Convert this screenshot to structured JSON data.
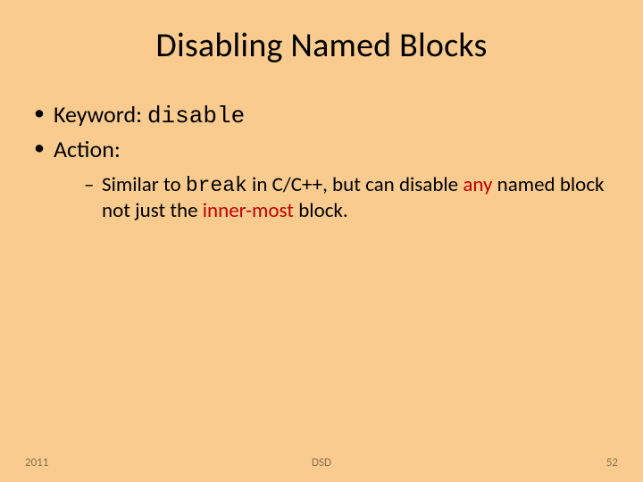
{
  "title": "Disabling Named Blocks",
  "bullets": {
    "b1_prefix": "Keyword: ",
    "b1_code": "disable",
    "b2": "Action:"
  },
  "sub": {
    "s1_prefix": "Similar to ",
    "s1_code": "break",
    "s1_mid1": " in C/C++, but can disable ",
    "s1_hl1": "any",
    "s1_mid2": " named block not just the ",
    "s1_hl2": "inner-most",
    "s1_tail": " block."
  },
  "footer": {
    "left": "2011",
    "center": "DSD",
    "right": "52"
  }
}
